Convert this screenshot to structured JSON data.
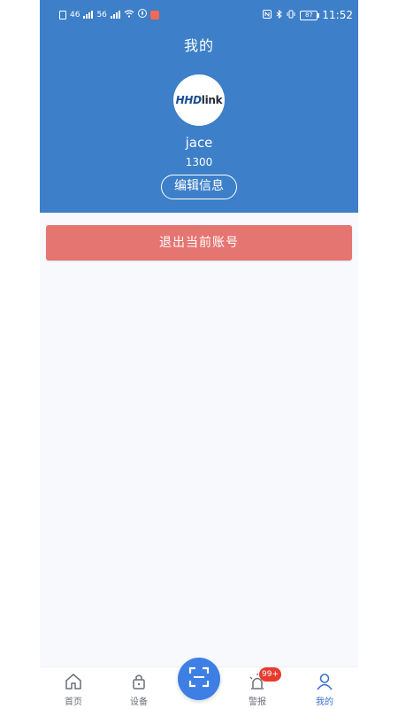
{
  "status_bar": {
    "network_left": "46",
    "network_right": "56",
    "battery": "87",
    "time": "11:52"
  },
  "header": {
    "title": "我的",
    "avatar_logo_main": "HHD",
    "avatar_logo_sub": "link",
    "username": "jace",
    "user_id": "1300",
    "edit_button_label": "编辑信息"
  },
  "actions": {
    "logout_label": "退出当前账号"
  },
  "tabbar": {
    "items": [
      {
        "label": "首页",
        "icon": "home-icon"
      },
      {
        "label": "设备",
        "icon": "lock-icon"
      },
      {
        "label": "",
        "icon": "scan-icon"
      },
      {
        "label": "警报",
        "icon": "alarm-icon"
      },
      {
        "label": "我的",
        "icon": "user-icon"
      }
    ],
    "alarm_badge": "99+"
  },
  "colors": {
    "header_bg": "#3d7fc8",
    "logout_bg": "#e57571",
    "accent": "#3a6ed0",
    "badge": "#e63b2e"
  }
}
